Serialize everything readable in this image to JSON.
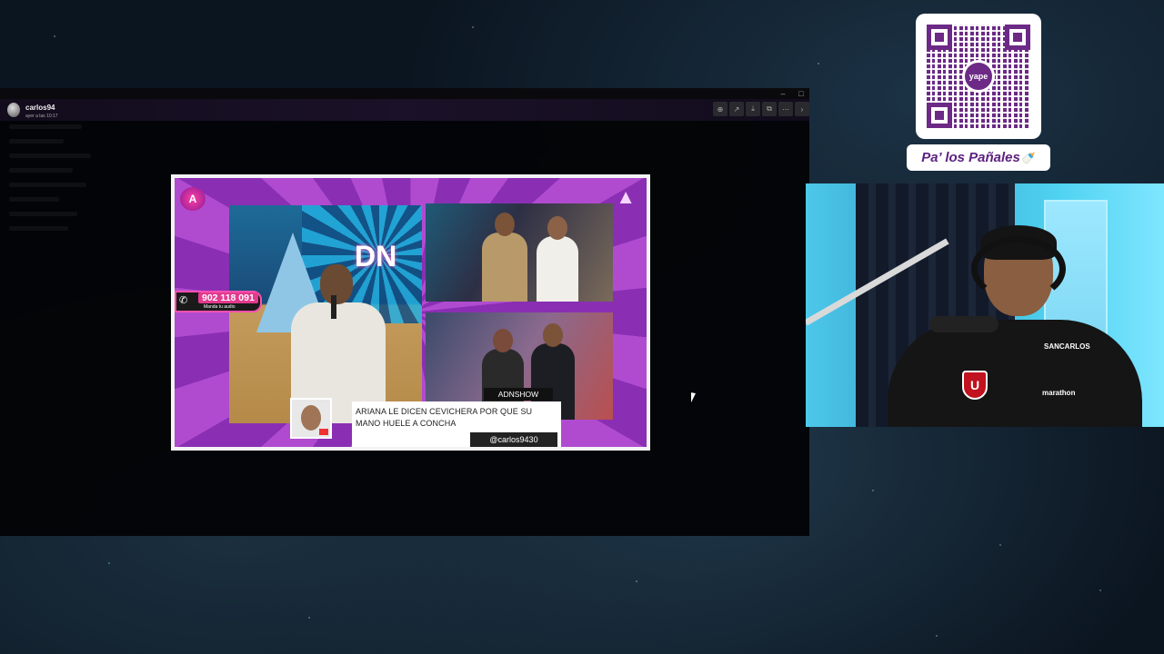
{
  "viewer": {
    "user_name": "carlos94",
    "user_time": "ayer a las 10:17",
    "tools": [
      "zoom-in-icon",
      "share-icon",
      "download-icon",
      "open-external-icon",
      "more-icon",
      "chevron-right-icon"
    ]
  },
  "shared_image": {
    "phone_number": "902 118 091",
    "phone_sub": "Manda tu audio",
    "show_label": "ADNSHOW",
    "caption": "ARIANA LE DICEN CEVICHERA POR QUE SU MANO HUELE A CONCHA",
    "handle": "@carlos9430"
  },
  "overlay": {
    "donation_label": "Pa’ los Pañales",
    "qr_center_label": "yape"
  },
  "webcam": {
    "sponsor": "SANCARLOS",
    "sponsor2": "marathon"
  },
  "colors": {
    "frame_purple": "#b04bd0",
    "accent_pink": "#e33a8e",
    "qr_purple": "#6c2a86"
  }
}
